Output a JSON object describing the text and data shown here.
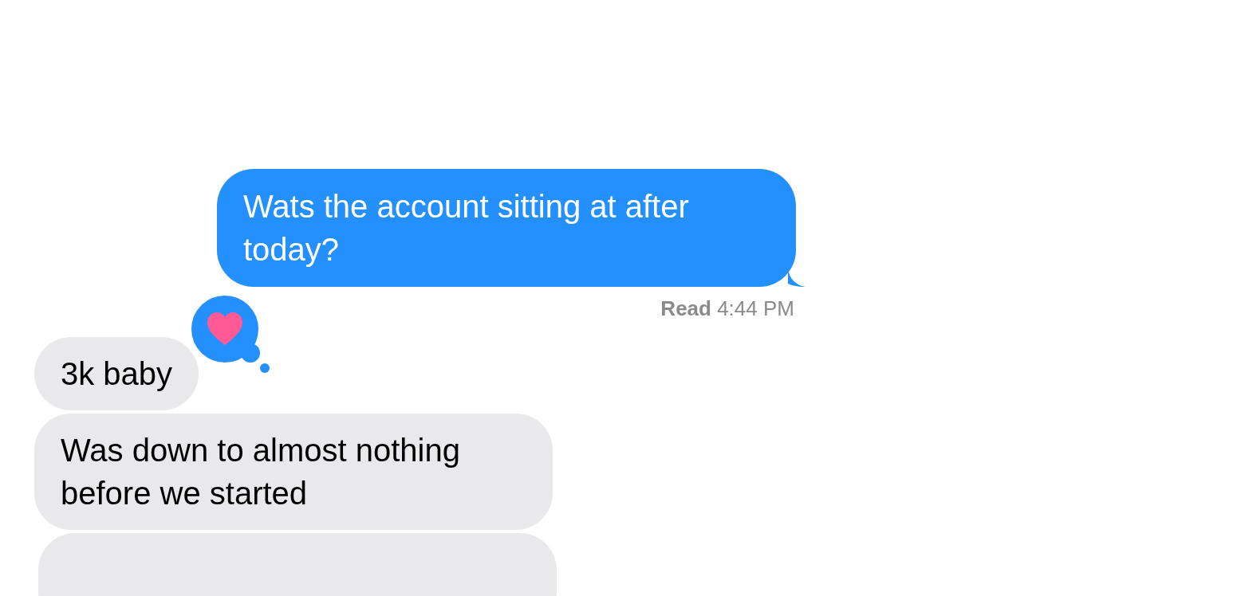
{
  "messages": [
    {
      "kind": "sent",
      "text": "Wats the account sitting at after today?",
      "receipt": "**Read** 4:44 PM"
    },
    {
      "kind": "received",
      "text": "3k baby",
      "reaction": {
        "kind": "heart"
      }
    },
    {
      "kind": "received",
      "text": "Was down to almost nothing before we started"
    },
    {
      "kind": "received"
    }
  ]
}
